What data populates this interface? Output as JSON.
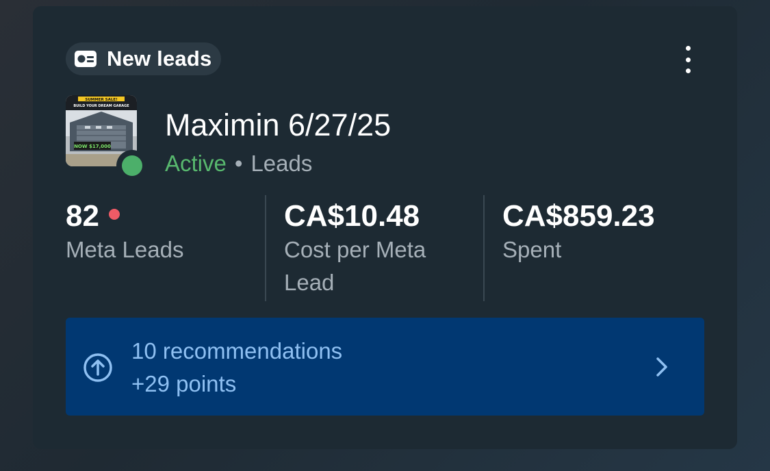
{
  "card": {
    "badge_label": "New leads",
    "badge_icon": "id-card-icon",
    "menu_icon": "more-vertical-icon"
  },
  "campaign": {
    "name": "Maximin 6/27/25",
    "status": "Active",
    "separator": "•",
    "objective": "Leads",
    "status_color": "#58b86e",
    "thumbnail": {
      "banner_text": "SUMMER SALE!",
      "headline_text": "BUILD YOUR DREAM GARAGE",
      "price_text": "NOW $17,000"
    }
  },
  "metrics": [
    {
      "value": "82",
      "label": "Meta Leads",
      "has_alert_dot": true
    },
    {
      "value": "CA$10.48",
      "label": "Cost per Meta Lead"
    },
    {
      "value": "CA$859.23",
      "label": "Spent"
    }
  ],
  "recommendations": {
    "title": "10 recommendations",
    "subtitle": "+29 points",
    "icon": "arrow-up-circle-icon",
    "chevron_icon": "chevron-right-icon",
    "background_color": "#013872",
    "text_color": "#8fc0f2"
  },
  "colors": {
    "card_bg": "#1d2a33",
    "alert_dot": "#ef5b66",
    "muted_text": "#a6b0b8"
  }
}
